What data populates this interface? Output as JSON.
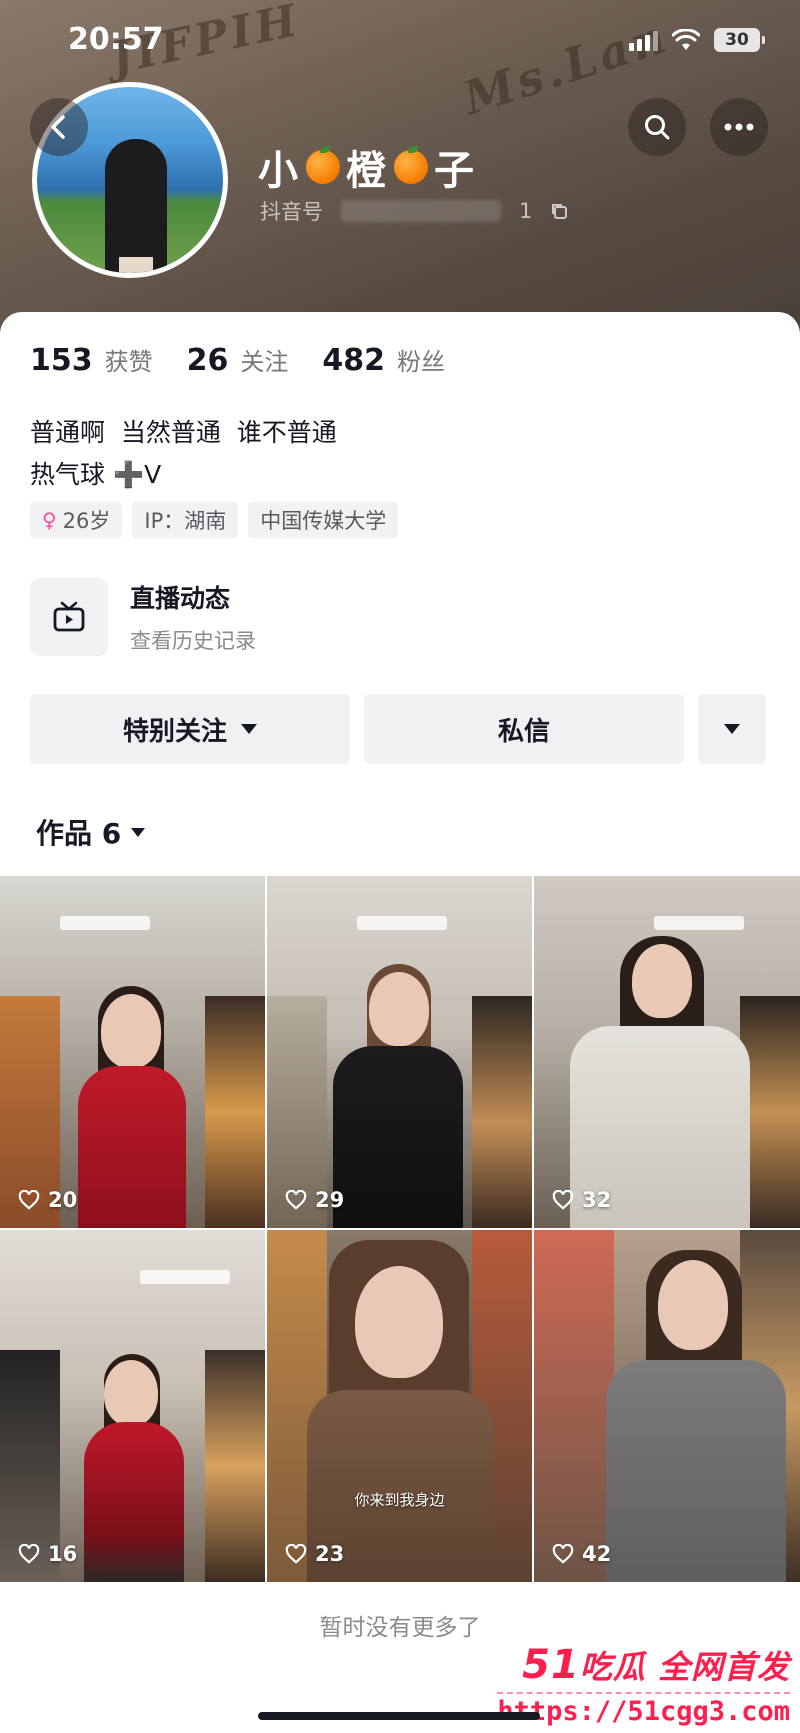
{
  "status_bar": {
    "time": "20:57",
    "battery": "30"
  },
  "background_scribble": [
    "JIFPIH",
    "Ms.Lan"
  ],
  "profile": {
    "name_parts": [
      "小",
      "橙",
      "子"
    ],
    "douyin_id_label": "抖音号",
    "douyin_id_tail": "1"
  },
  "stats": [
    {
      "value": "153",
      "label": "获赞"
    },
    {
      "value": "26",
      "label": "关注"
    },
    {
      "value": "482",
      "label": "粉丝"
    }
  ],
  "bio": {
    "line1": "普通啊  当然普通  谁不普通",
    "line2": "热气球 ➕V"
  },
  "tags": {
    "age": "26岁",
    "ip": "IP：湖南",
    "school": "中国传媒大学"
  },
  "live": {
    "title": "直播动态",
    "subtitle": "查看历史记录"
  },
  "actions": {
    "follow": "特别关注",
    "message": "私信"
  },
  "works_tab": {
    "label": "作品 6"
  },
  "videos": [
    {
      "likes": "20"
    },
    {
      "likes": "29"
    },
    {
      "likes": "32"
    },
    {
      "likes": "16"
    },
    {
      "likes": "23",
      "caption": "你来到我身边"
    },
    {
      "likes": "42"
    }
  ],
  "footer": {
    "no_more": "暂时没有更多了"
  },
  "watermark": {
    "brand_num": "51",
    "brand_text": "吃瓜 全网首发",
    "url": "https://51cgg3.com"
  },
  "colors": {
    "accent_red": "#ff1f4f",
    "tag_bg": "#f2f2f4",
    "header_bg": "#6f6054"
  }
}
